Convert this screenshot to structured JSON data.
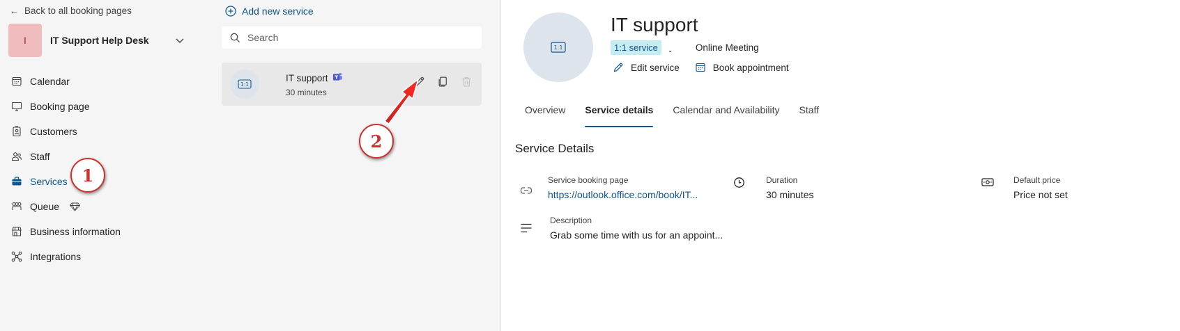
{
  "nav": {
    "back_label": "Back to all booking pages",
    "booking_page": {
      "avatar_letter": "I",
      "name": "IT Support Help Desk"
    },
    "items": [
      {
        "label": "Calendar",
        "icon": "calendar-icon",
        "active": false
      },
      {
        "label": "Booking page",
        "icon": "monitor-icon",
        "active": false
      },
      {
        "label": "Customers",
        "icon": "contact-card-icon",
        "active": false
      },
      {
        "label": "Staff",
        "icon": "people-icon",
        "active": false
      },
      {
        "label": "Services",
        "icon": "briefcase-icon",
        "active": true
      },
      {
        "label": "Queue",
        "icon": "people-queue-icon",
        "active": false,
        "premium_icon": "diamond-icon"
      },
      {
        "label": "Business information",
        "icon": "building-shop-icon",
        "active": false
      },
      {
        "label": "Integrations",
        "icon": "connections-icon",
        "active": false
      }
    ]
  },
  "services_list": {
    "add_label": "Add new service",
    "search_placeholder": "Search",
    "items": [
      {
        "icon_text": "1:1",
        "name": "IT support",
        "duration": "30 minutes",
        "teams_icon": "teams-icon"
      }
    ]
  },
  "detail": {
    "icon_text": "1:1",
    "title": "IT support",
    "badge": "1:1 service",
    "separator": ".",
    "meeting_type": "Online Meeting",
    "edit_label": "Edit service",
    "book_label": "Book appointment",
    "tabs": [
      "Overview",
      "Service details",
      "Calendar and Availability",
      "Staff"
    ],
    "active_tab": "Service details",
    "section_title": "Service Details",
    "fields": {
      "booking_page": {
        "label": "Service booking page",
        "value": "https://outlook.office.com/book/IT..."
      },
      "duration": {
        "label": "Duration",
        "value": "30 minutes"
      },
      "price": {
        "label": "Default price",
        "value": "Price not set"
      },
      "description": {
        "label": "Description",
        "value": "Grab some time with us for an appoint..."
      }
    }
  },
  "annotations": {
    "step1": "1",
    "step2": "2",
    "color": "#d0312d"
  },
  "colors": {
    "accent": "#0f548c",
    "avatar_bg": "#f1bcbe",
    "badge_bg": "#c6ebf1"
  }
}
